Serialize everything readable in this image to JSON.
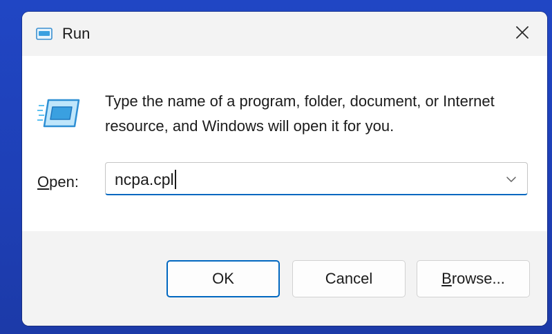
{
  "dialog": {
    "title": "Run",
    "description": "Type the name of a program, folder, document, or Internet resource, and Windows will open it for you."
  },
  "open_field": {
    "label_mnemonic": "O",
    "label_rest": "pen:",
    "value": "ncpa.cpl"
  },
  "buttons": {
    "ok": "OK",
    "cancel": "Cancel",
    "browse_mnemonic": "B",
    "browse_rest": "rowse..."
  },
  "colors": {
    "accent": "#0067c0",
    "icon_blue": "#3aa0e0",
    "desktop": "#1e3fb5"
  },
  "icons": {
    "title": "run-icon",
    "close": "close-icon",
    "dropdown": "chevron-down-icon"
  }
}
